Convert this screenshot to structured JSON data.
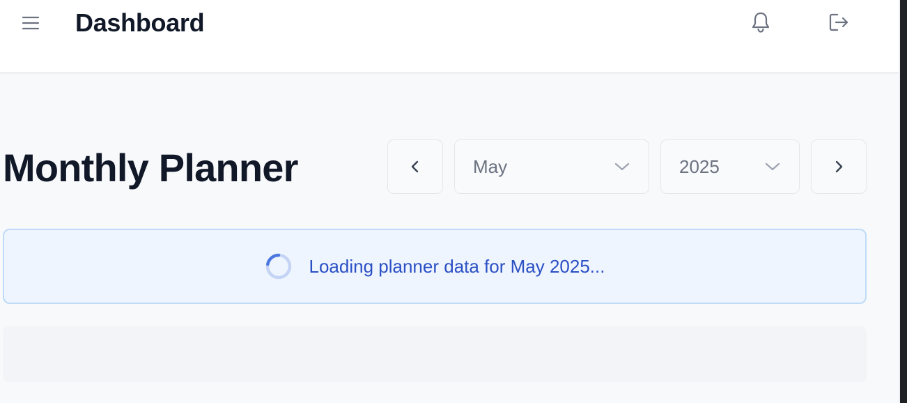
{
  "header": {
    "title": "Dashboard",
    "menu_icon": "hamburger-menu-icon",
    "notifications_icon": "bell-icon",
    "logout_icon": "logout-icon"
  },
  "planner": {
    "title": "Monthly Planner",
    "prev_icon": "chevron-left-icon",
    "next_icon": "chevron-right-icon",
    "month": {
      "selected": "May",
      "icon": "chevron-down-icon"
    },
    "year": {
      "selected": "2025",
      "icon": "chevron-down-icon"
    }
  },
  "loading": {
    "message": "Loading planner data for May 2025...",
    "icon": "spinner-icon"
  },
  "colors": {
    "title_text": "#111827",
    "loading_text": "#2b4fc4",
    "loading_bg": "#eef5fe",
    "loading_border": "#bfdbf8",
    "spinner_accent": "#4a78e0",
    "spinner_track": "#c5d4f5"
  }
}
